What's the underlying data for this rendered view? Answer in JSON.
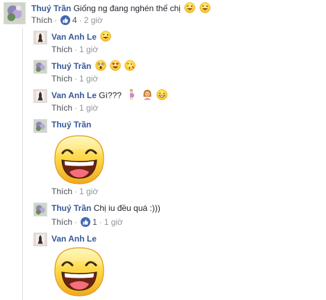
{
  "comments": [
    {
      "author": "Thuý Trần",
      "text": "Giống ng đang nghén thế chị",
      "emojis": [
        "winking-tongue-emoji",
        "winking-tongue-emoji"
      ],
      "like_label": "Thích",
      "like_count": "4",
      "time": "2 giờ"
    },
    {
      "author": "Van Anh Le",
      "text": "",
      "emojis": [
        "winking-tongue-emoji"
      ],
      "like_label": "Thích",
      "time": "1 giờ"
    },
    {
      "author": "Thuý Trần",
      "text": "",
      "emojis": [
        "astonished-emoji",
        "heart-eyes-emoji",
        "kissing-heart-emoji"
      ],
      "like_label": "Thích",
      "time": "1 giờ"
    },
    {
      "author": "Van Anh Le",
      "text": "Gì???",
      "emojis": [
        "pregnant-woman-emoji",
        "woman-pouting-emoji",
        "grinning-emoji"
      ],
      "like_label": "Thích",
      "time": "1 giờ"
    },
    {
      "author": "Thuý Trần",
      "text": "",
      "sticker": "laughing-sticker",
      "like_label": "Thích",
      "time": "1 giờ"
    },
    {
      "author": "Thuý Trần",
      "text": "Chị iu đều quá :)))",
      "like_label": "Thích",
      "like_count": "1",
      "time": "1 giờ"
    },
    {
      "author": "Van Anh Le",
      "text": "",
      "sticker": "laughing-sticker"
    }
  ],
  "colors": {
    "author": "#365899",
    "meta": "#90949c",
    "like_badge": "#4267b2",
    "sticker": "#f7c13b"
  }
}
